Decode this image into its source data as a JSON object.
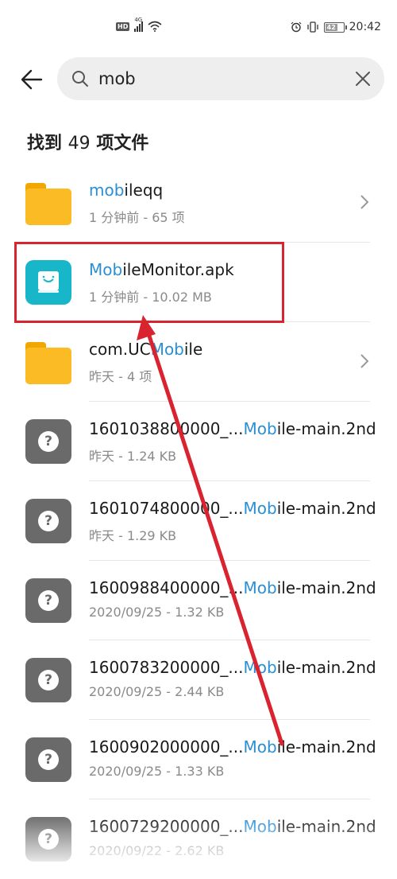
{
  "status_bar": {
    "hd": "HD",
    "network": "4G",
    "battery": "42",
    "time": "20:42"
  },
  "search": {
    "query": "mob",
    "placeholder": ""
  },
  "results": {
    "prefix": "找到 ",
    "count": "49",
    "suffix": " 项文件"
  },
  "files": [
    {
      "type": "folder",
      "name_pre": "",
      "name_hl": "mob",
      "name_post": "ileqq",
      "meta": "1 分钟前 - 65 项",
      "has_chevron": true
    },
    {
      "type": "apk",
      "name_pre": "",
      "name_hl": "Mob",
      "name_post": "ileMonitor.apk",
      "meta": "1 分钟前 - 10.02 MB",
      "has_chevron": false
    },
    {
      "type": "folder",
      "name_pre": "com.UC",
      "name_hl": "Mob",
      "name_post": "ile",
      "meta": "昨天 - 4 项",
      "has_chevron": true
    },
    {
      "type": "unknown",
      "name_pre": "1601038800000_...",
      "name_hl": "Mob",
      "name_post": "ile-main.2nd",
      "meta": "昨天 - 1.24 KB",
      "has_chevron": false
    },
    {
      "type": "unknown",
      "name_pre": "1601074800000_...",
      "name_hl": "Mob",
      "name_post": "ile-main.2nd",
      "meta": "昨天 - 1.29 KB",
      "has_chevron": false
    },
    {
      "type": "unknown",
      "name_pre": "1600988400000_...",
      "name_hl": "Mob",
      "name_post": "ile-main.2nd",
      "meta": "2020/09/25 - 1.32 KB",
      "has_chevron": false
    },
    {
      "type": "unknown",
      "name_pre": "1600783200000_...",
      "name_hl": "Mob",
      "name_post": "ile-main.2nd",
      "meta": "2020/09/25 - 2.44 KB",
      "has_chevron": false
    },
    {
      "type": "unknown",
      "name_pre": "1600902000000_...",
      "name_hl": "Mob",
      "name_post": "ile-main.2nd",
      "meta": "2020/09/25 - 1.33 KB",
      "has_chevron": false
    },
    {
      "type": "unknown",
      "name_pre": "1600729200000_...",
      "name_hl": "Mob",
      "name_post": "ile-main.2nd",
      "meta": "2020/09/22 - 2.62 KB",
      "has_chevron": false
    }
  ],
  "colors": {
    "highlight_text": "#2a8fd4",
    "annotation_red": "#d9232e",
    "folder": "#fbbb24",
    "apk": "#17b6c9"
  },
  "icons": {
    "back": "arrow-left-icon",
    "search": "search-icon",
    "clear": "close-icon",
    "folder": "folder-icon",
    "apk": "apk-app-icon",
    "unknown": "unknown-file-icon",
    "chevron": "chevron-right-icon"
  }
}
